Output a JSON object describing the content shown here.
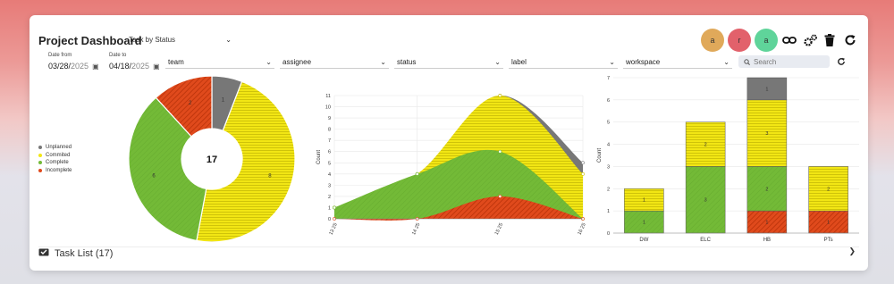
{
  "header": {
    "title": "Project Dashboard",
    "view_select": "Task by Status"
  },
  "avatars": [
    {
      "initial": "a",
      "color": "#e0a95a"
    },
    {
      "initial": "r",
      "color": "#e2616b"
    },
    {
      "initial": "a",
      "color": "#5fd49a"
    }
  ],
  "toolbar": {
    "icons": [
      "link-icon",
      "gears-icon",
      "trash-icon",
      "refresh-icon"
    ]
  },
  "date_from": {
    "label": "Date from",
    "month_day": "03/28/",
    "year": "2025"
  },
  "date_to": {
    "label": "Date to",
    "month_day": "04/18/",
    "year": "2025"
  },
  "filters": [
    "team",
    "assignee",
    "status",
    "label",
    "workspace"
  ],
  "search": {
    "placeholder": "Search"
  },
  "task_list": {
    "label": "Task List (17)"
  },
  "chart_data": [
    {
      "type": "pie",
      "center_label": "17",
      "series": [
        {
          "name": "Unplanned",
          "value": 1,
          "color": "#777777"
        },
        {
          "name": "Commited",
          "value": 8,
          "color": "#f2e614"
        },
        {
          "name": "Complete",
          "value": 6,
          "color": "#73ba37"
        },
        {
          "name": "Incomplete",
          "value": 2,
          "color": "#e04a1c"
        }
      ],
      "legend": "left"
    },
    {
      "type": "area",
      "ylabel": "Count",
      "x": [
        "13 25",
        "14 25",
        "15 25",
        "16 25"
      ],
      "ylim": [
        0,
        11
      ],
      "yticks": [
        0,
        1,
        2,
        3,
        4,
        5,
        6,
        7,
        8,
        9,
        10,
        11
      ],
      "series": [
        {
          "name": "Incomplete",
          "values": [
            0,
            0,
            2,
            0
          ],
          "color": "#e04a1c"
        },
        {
          "name": "Complete",
          "values": [
            1,
            4,
            6,
            0
          ],
          "color": "#73ba37"
        },
        {
          "name": "Commited",
          "values": [
            1,
            4,
            11,
            4
          ],
          "color": "#f2e614"
        },
        {
          "name": "Unplanned",
          "values": [
            1,
            4,
            11,
            5
          ],
          "color": "#777777"
        }
      ]
    },
    {
      "type": "bar",
      "ylabel": "Count",
      "categories": [
        "DW",
        "ELC",
        "HB",
        "PTs"
      ],
      "ylim": [
        0,
        7
      ],
      "yticks": [
        0,
        1,
        2,
        3,
        4,
        5,
        6,
        7
      ],
      "series": [
        {
          "name": "Incomplete",
          "values": [
            0,
            0,
            1,
            1
          ],
          "color": "#e04a1c"
        },
        {
          "name": "Complete",
          "values": [
            1,
            3,
            2,
            0
          ],
          "color": "#73ba37"
        },
        {
          "name": "Commited",
          "values": [
            1,
            2,
            3,
            2
          ],
          "color": "#f2e614"
        },
        {
          "name": "Unplanned",
          "values": [
            0,
            0,
            1,
            0
          ],
          "color": "#777777"
        }
      ]
    }
  ]
}
